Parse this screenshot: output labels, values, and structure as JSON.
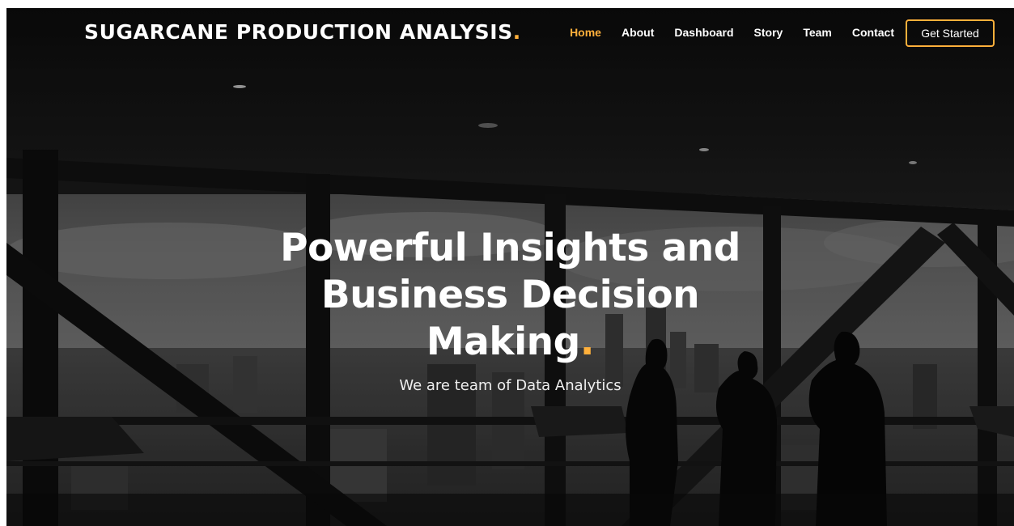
{
  "brand": {
    "title": "SUGARCANE PRODUCTION ANALYSIS",
    "dot": "."
  },
  "nav": {
    "items": [
      {
        "label": "Home",
        "active": true
      },
      {
        "label": "About"
      },
      {
        "label": "Dashboard"
      },
      {
        "label": "Story"
      },
      {
        "label": "Team"
      },
      {
        "label": "Contact"
      }
    ],
    "cta_label": "Get Started"
  },
  "hero": {
    "title_line1": "Powerful Insights and",
    "title_line2": "Business Decision",
    "title_line3": "Making",
    "title_dot": ".",
    "subtitle": "We are team of Data Analytics"
  },
  "colors": {
    "accent": "#ffb03b",
    "text": "#ffffff",
    "background": "#1a1a1a"
  }
}
